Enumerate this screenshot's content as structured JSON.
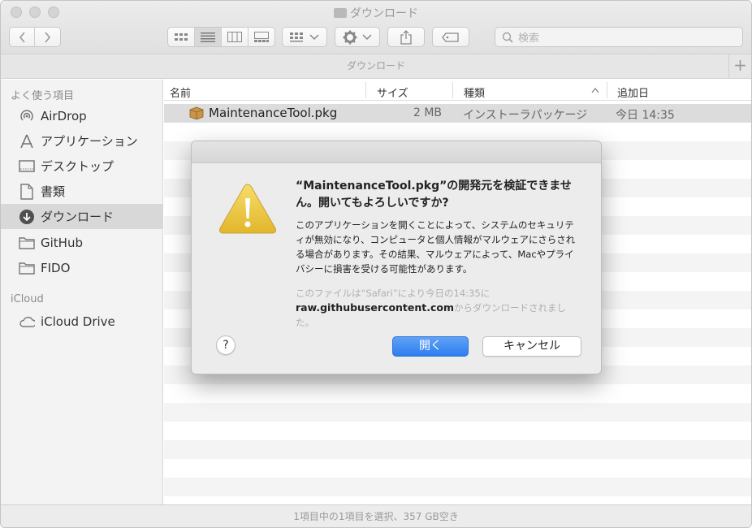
{
  "window": {
    "title": "ダウンロード",
    "path_title": "ダウンロード",
    "status": "1項目中の1項目を選択、357 GB空き"
  },
  "toolbar": {
    "search_placeholder": "検索",
    "add_label": "+"
  },
  "sidebar": {
    "favorites_header": "よく使う項目",
    "icloud_header": "iCloud",
    "items": [
      {
        "label": "AirDrop",
        "icon": "airdrop-icon"
      },
      {
        "label": "アプリケーション",
        "icon": "applications-icon"
      },
      {
        "label": "デスクトップ",
        "icon": "desktop-icon"
      },
      {
        "label": "書類",
        "icon": "documents-icon"
      },
      {
        "label": "ダウンロード",
        "icon": "downloads-icon",
        "selected": true
      },
      {
        "label": "GitHub",
        "icon": "folder-icon"
      },
      {
        "label": "FIDO",
        "icon": "folder-icon"
      }
    ],
    "icloud_items": [
      {
        "label": "iCloud Drive",
        "icon": "cloud-icon"
      }
    ]
  },
  "list": {
    "columns": [
      "名前",
      "サイズ",
      "種類",
      "追加日"
    ],
    "rows": [
      {
        "name": "MaintenanceTool.pkg",
        "size": "2 MB",
        "kind": "インストーラパッケージ",
        "added": "今日 14:35"
      }
    ]
  },
  "dialog": {
    "title": "“MaintenanceTool.pkg”の開発元を検証できません。開いてもよろしいですか?",
    "body": "このアプリケーションを開くことによって、システムのセキュリティが無効になり、コンピュータと個人情報がマルウェアにさらされる場合があります。その結果、マルウェアによって、Macやプライバシーに損害を受ける可能性があります。",
    "source_prefix": "このファイルは“Safari”により今日の14:35に",
    "source_host": "raw.githubusercontent.com",
    "source_suffix": "からダウンロードされました。",
    "help_label": "?",
    "open_label": "開く",
    "cancel_label": "キャンセル",
    "accent": "#2e7ef0"
  }
}
